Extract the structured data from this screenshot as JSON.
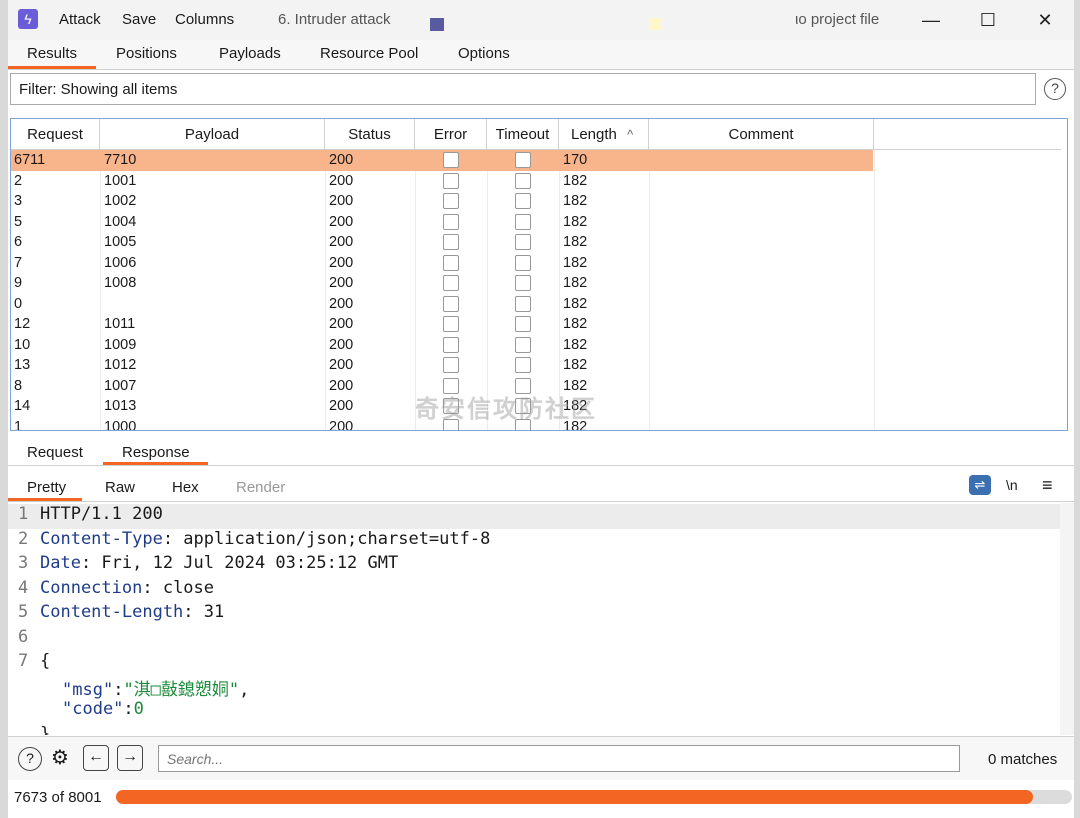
{
  "titlebar": {
    "menu": [
      "Attack",
      "Save",
      "Columns"
    ],
    "window_title": "6. Intruder attack",
    "right_text": "ιο project file"
  },
  "tabs": [
    "Results",
    "Positions",
    "Payloads",
    "Resource Pool",
    "Options"
  ],
  "filter": {
    "text": "Filter: Showing all items"
  },
  "table": {
    "columns": [
      "Request",
      "Payload",
      "Status",
      "Error",
      "Timeout",
      "Length",
      "Comment"
    ],
    "sort_indicator": "^",
    "rows": [
      {
        "request": "6711",
        "payload": "7710",
        "status": "200",
        "length": "170"
      },
      {
        "request": "2",
        "payload": "1001",
        "status": "200",
        "length": "182"
      },
      {
        "request": "3",
        "payload": "1002",
        "status": "200",
        "length": "182"
      },
      {
        "request": "5",
        "payload": "1004",
        "status": "200",
        "length": "182"
      },
      {
        "request": "6",
        "payload": "1005",
        "status": "200",
        "length": "182"
      },
      {
        "request": "7",
        "payload": "1006",
        "status": "200",
        "length": "182"
      },
      {
        "request": "9",
        "payload": "1008",
        "status": "200",
        "length": "182"
      },
      {
        "request": "0",
        "payload": "",
        "status": "200",
        "length": "182"
      },
      {
        "request": "12",
        "payload": "1011",
        "status": "200",
        "length": "182"
      },
      {
        "request": "10",
        "payload": "1009",
        "status": "200",
        "length": "182"
      },
      {
        "request": "13",
        "payload": "1012",
        "status": "200",
        "length": "182"
      },
      {
        "request": "8",
        "payload": "1007",
        "status": "200",
        "length": "182"
      },
      {
        "request": "14",
        "payload": "1013",
        "status": "200",
        "length": "182"
      },
      {
        "request": "1",
        "payload": "1000",
        "status": "200",
        "length": "182"
      }
    ],
    "watermark": "奇安信攻防社区"
  },
  "subtabs": [
    "Request",
    "Response"
  ],
  "viewtabs": [
    "Pretty",
    "Raw",
    "Hex",
    "Render"
  ],
  "viewtools": {
    "wrap": "⇌",
    "newline": "\\n",
    "menu": "≡"
  },
  "response": {
    "lines": [
      {
        "n": "1",
        "key": "HTTP/1.1 200",
        "val": ""
      },
      {
        "n": "2",
        "key": "Content-Type",
        "val": ": application/json;charset=utf-8"
      },
      {
        "n": "3",
        "key": "Date",
        "val": ": Fri, 12 Jul 2024 03:25:12 GMT"
      },
      {
        "n": "4",
        "key": "Connection",
        "val": ": close"
      },
      {
        "n": "5",
        "key": "Content-Length",
        "val": ": 31"
      },
      {
        "n": "6",
        "key": "",
        "val": ""
      },
      {
        "n": "7",
        "key": "{",
        "val": ""
      }
    ],
    "json_msg_key": "\"msg\"",
    "json_msg_val": "\"淇□敼鎴愬姛\"",
    "json_code_key": "\"code\"",
    "json_code_val": "0",
    "closing": "}"
  },
  "search": {
    "placeholder": "Search...",
    "matches": "0 matches"
  },
  "progress": {
    "label": "7673 of 8001",
    "done": 7673,
    "total": 8001
  }
}
